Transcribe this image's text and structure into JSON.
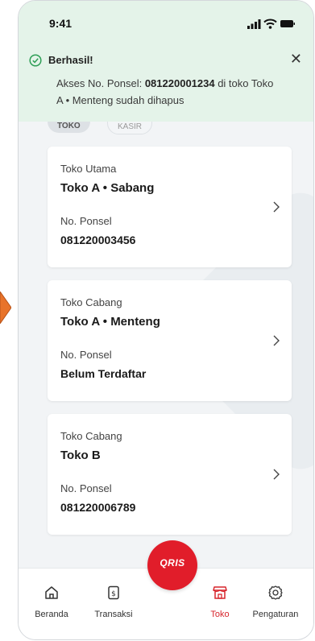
{
  "status_bar": {
    "time": "9:41"
  },
  "toast": {
    "title": "Berhasil!",
    "message_prefix": "Akses No. Ponsel: ",
    "message_phone": "081220001234",
    "message_suffix": " di toko Toko A • Menteng sudah dihapus",
    "close_symbol": "✕"
  },
  "tabs": [
    {
      "label": "TOKO"
    },
    {
      "label": "KASIR"
    }
  ],
  "stores": [
    {
      "type": "Toko Utama",
      "name": "Toko A • Sabang",
      "phone_label": "No. Ponsel",
      "phone": "081220003456"
    },
    {
      "type": "Toko Cabang",
      "name": "Toko A • Menteng",
      "phone_label": "No. Ponsel",
      "phone": "Belum Terdaftar"
    },
    {
      "type": "Toko Cabang",
      "name": "Toko B",
      "phone_label": "No. Ponsel",
      "phone": "081220006789"
    }
  ],
  "qris": {
    "label": "QRIS"
  },
  "nav": [
    {
      "label": "Beranda",
      "icon": "home-icon"
    },
    {
      "label": "Transaksi",
      "icon": "receipt-icon"
    },
    {
      "label": "Toko",
      "icon": "store-icon",
      "active": true
    },
    {
      "label": "Pengaturan",
      "icon": "gear-icon"
    }
  ],
  "colors": {
    "accent": "#e11d2a",
    "toast_bg": "#e4f3e9",
    "success": "#2e9e56",
    "arrow": "#e8732a"
  }
}
